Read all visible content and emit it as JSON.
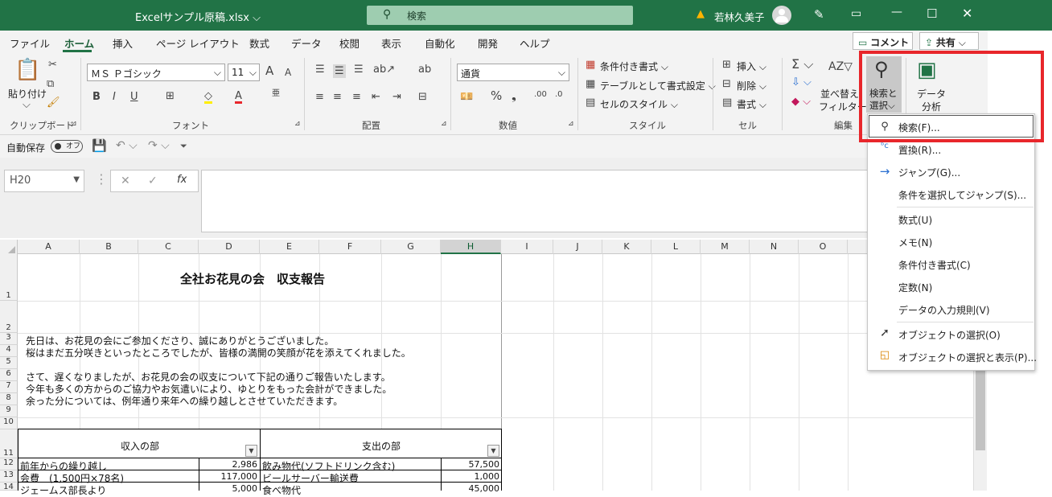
{
  "title": {
    "filename": "Excelサンプル原稿.xlsx",
    "search_placeholder": "検索",
    "user": "若林久美子",
    "warning": "▲"
  },
  "tabs": [
    "ファイル",
    "ホーム",
    "挿入",
    "ページ レイアウト",
    "数式",
    "データ",
    "校閲",
    "表示",
    "自動化",
    "開発",
    "ヘルプ"
  ],
  "actions": {
    "comment": "コメント",
    "share": "共有"
  },
  "ribbon": {
    "clipboard": {
      "paste": "貼り付け",
      "label": "クリップボード"
    },
    "font": {
      "name": "ＭＳ Ｐゴシック",
      "size": "11",
      "label": "フォント",
      "a_up": "A",
      "a_down": "A"
    },
    "alignment": {
      "label": "配置"
    },
    "number": {
      "format": "通貨",
      "label": "数値"
    },
    "style": {
      "cond": "条件付き書式",
      "table": "テーブルとして書式設定",
      "cellstyle": "セルのスタイル",
      "label": "スタイル"
    },
    "cells": {
      "insert": "挿入",
      "delete": "削除",
      "format": "書式",
      "label": "セル"
    },
    "edit": {
      "sortfilter_1": "並べ替え",
      "sortfilter_2": "フィルター",
      "findselect_1": "検索と",
      "findselect_2": "選択",
      "label": "編集"
    },
    "analysis": {
      "l1": "データ",
      "l2": "分析"
    }
  },
  "qat": {
    "autosave": "自動保存",
    "toggle": "オフ"
  },
  "formula": {
    "namebox": "H20",
    "fx": "fx"
  },
  "columns": [
    "A",
    "B",
    "C",
    "D",
    "E",
    "F",
    "G",
    "H",
    "I",
    "J",
    "K",
    "L",
    "M",
    "N",
    "O"
  ],
  "rows": [
    "1",
    "2",
    "3",
    "4",
    "5",
    "6",
    "7",
    "8",
    "9",
    "10",
    "11",
    "12",
    "13",
    "14"
  ],
  "sheet": {
    "title": "全社お花見の会　収支報告",
    "lines": [
      "先日は、お花見の会にご参加くださり、誠にありがとうございました。",
      "桜はまだ五分咲きといったところでしたが、皆様の満開の笑顔が花を添えてくれました。",
      "さて、遅くなりましたが、お花見の会の収支について下記の通りご報告いたします。",
      "今年も多くの方からのご協力やお気遣いにより、ゆとりをもった会計ができました。",
      "余った分については、例年通り来年への繰り越しとさせていただきます。"
    ],
    "income_header": "収入の部",
    "expense_header": "支出の部",
    "income": [
      {
        "item": "前年からの繰り越し",
        "amount": "2,986"
      },
      {
        "item": "会費　(1,500円×78名)",
        "amount": "117,000"
      },
      {
        "item": "ジェームス部長より",
        "amount": "5,000"
      }
    ],
    "expense": [
      {
        "item": "飲み物代(ソフトドリンク含む)",
        "amount": "57,500"
      },
      {
        "item": "ビールサーバー輸送費",
        "amount": "1,000"
      },
      {
        "item": "食べ物代",
        "amount": "45,000"
      }
    ]
  },
  "menu": {
    "items": [
      "検索(F)...",
      "置換(R)...",
      "ジャンプ(G)...",
      "条件を選択してジャンプ(S)...",
      "数式(U)",
      "メモ(N)",
      "条件付き書式(C)",
      "定数(N)",
      "データの入力規則(V)",
      "オブジェクトの選択(O)",
      "オブジェクトの選択と表示(P)..."
    ]
  },
  "colors": {
    "excel_green": "#217346",
    "highlight": "#e8262b"
  }
}
